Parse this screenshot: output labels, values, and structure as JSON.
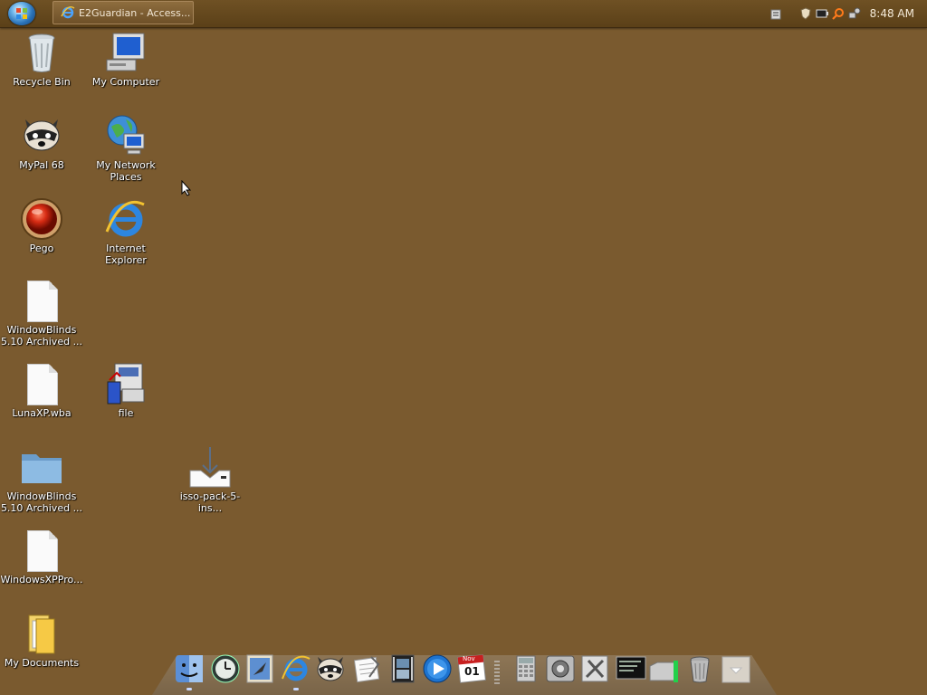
{
  "taskbar": {
    "task_label": "E2Guardian - Access...",
    "clock": "8:48 AM"
  },
  "desktop": {
    "icons": [
      {
        "label": "Recycle Bin"
      },
      {
        "label": "My Computer"
      },
      {
        "label": "MyPal 68"
      },
      {
        "label": "My Network Places"
      },
      {
        "label": "Pego"
      },
      {
        "label": "Internet Explorer"
      },
      {
        "label": "WindowBlinds 5.10 Archived ..."
      },
      {
        "label": "LunaXP.wba"
      },
      {
        "label": "file"
      },
      {
        "label": "WindowBlinds 5.10 Archived ..."
      },
      {
        "label": "isso-pack-5-ins..."
      },
      {
        "label": "WindowsXPPro..."
      },
      {
        "label": "My Documents"
      }
    ]
  },
  "dock": {
    "calendar_month": "Nov",
    "calendar_day": "01",
    "items": [
      "finder-icon",
      "time-machine-icon",
      "mail-stamp-icon",
      "internet-explorer-icon",
      "raccoon-icon",
      "textedit-icon",
      "film-strip-icon",
      "media-player-icon",
      "calendar-icon",
      "separator",
      "calculator-icon",
      "system-preferences-icon",
      "utilities-icon",
      "console-icon",
      "drive-icon",
      "trash-icon",
      "stack-icon"
    ]
  },
  "colors": {
    "desktop": "#7a5a2f",
    "topbar": "#5b4018"
  }
}
